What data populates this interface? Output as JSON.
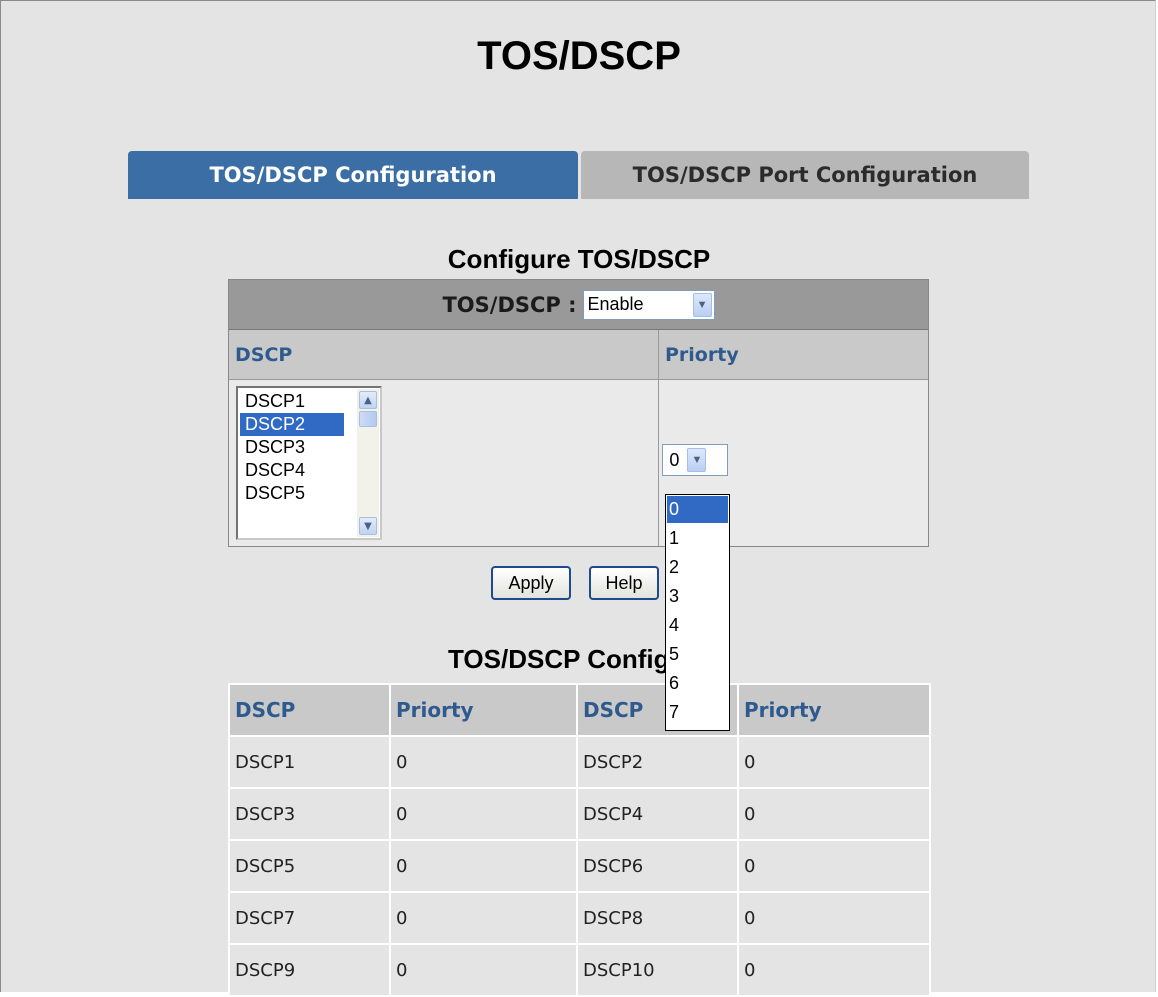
{
  "page": {
    "title": "TOS/DSCP"
  },
  "tabs": [
    {
      "label": "TOS/DSCP Configuration",
      "active": true
    },
    {
      "label": "TOS/DSCP Port Configuration",
      "active": false
    }
  ],
  "configure": {
    "title": "Configure TOS/DSCP",
    "mode_label": "TOS/DSCP :",
    "mode_value": "Enable",
    "col_dscp": "DSCP",
    "col_priority": "Priorty",
    "dscp_list": [
      "DSCP1",
      "DSCP2",
      "DSCP3",
      "DSCP4",
      "DSCP5"
    ],
    "dscp_selected": "DSCP2",
    "priority_value": "0",
    "priority_options": [
      "0",
      "1",
      "2",
      "3",
      "4",
      "5",
      "6",
      "7"
    ],
    "priority_selected": "0"
  },
  "buttons": {
    "apply": "Apply",
    "help": "Help"
  },
  "status": {
    "title": "TOS/DSCP Configure",
    "headers": [
      "DSCP",
      "Priorty",
      "DSCP",
      "Priorty"
    ],
    "rows": [
      [
        "DSCP1",
        "0",
        "DSCP2",
        "0"
      ],
      [
        "DSCP3",
        "0",
        "DSCP4",
        "0"
      ],
      [
        "DSCP5",
        "0",
        "DSCP6",
        "0"
      ],
      [
        "DSCP7",
        "0",
        "DSCP8",
        "0"
      ],
      [
        "DSCP9",
        "0",
        "DSCP10",
        "0"
      ]
    ]
  },
  "colors": {
    "active_tab": "#3a6ea5",
    "inactive_tab": "#b7b7b7",
    "header_text": "#2f5a8e",
    "selection": "#316ac5"
  }
}
